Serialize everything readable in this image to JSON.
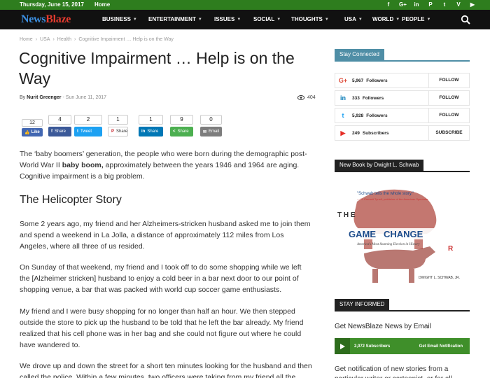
{
  "topbar": {
    "date": "Thursday, June 15, 2017",
    "home": "Home",
    "social_icons": [
      "f",
      "G+",
      "in",
      "P",
      "t",
      "V",
      "▶"
    ]
  },
  "nav": {
    "logo_a": "News",
    "logo_b": "Blaze",
    "items": [
      {
        "label": "BUSINESS",
        "caret": true
      },
      {
        "label": "ENTERTAINMENT",
        "caret": true
      },
      {
        "label": "ISSUES",
        "caret": true
      },
      {
        "label": "SOCIAL",
        "caret": true
      },
      {
        "label": "THOUGHTS",
        "caret": true
      },
      {
        "label": "USA",
        "caret": true
      },
      {
        "label": "WORLD",
        "caret": true
      },
      {
        "label": "PEOPLE",
        "caret": true
      }
    ]
  },
  "breadcrumb": [
    "Home",
    "›",
    "USA",
    "›",
    "Health",
    "›",
    "Cognitive Impairment … Help is on the Way"
  ],
  "article": {
    "title": "Cognitive Impairment … Help is on the Way",
    "by": "By",
    "author": "Nurit Greenger",
    "dash": "-",
    "date": "Sun June 11, 2017",
    "views": "404",
    "like_count": "12",
    "like_label": "Like",
    "shares": [
      {
        "count": "4",
        "label": "Share",
        "icon": "f",
        "color": "#3b5998"
      },
      {
        "count": "2",
        "label": "Tweet",
        "icon": "t",
        "color": "#1da1f2"
      },
      {
        "count": "1",
        "label": "Share",
        "icon": "P",
        "color": "#ffffff"
      },
      {
        "count": "1",
        "label": "Share",
        "icon": "in",
        "color": "#0077b5"
      },
      {
        "count": "9",
        "label": "Share",
        "icon": "<",
        "color": "#4caf50"
      },
      {
        "count": "0",
        "label": "Email",
        "icon": "✉",
        "color": "#7d7d7d"
      }
    ],
    "p1_a": "The ‘baby boomers’ generation, the people who were born during the demographic post-World War II ",
    "p1_b": "baby boom,",
    "p1_c": " approximately between the years 1946 and 1964 are aging. Cognitive impairment is a big problem.",
    "subhead": "The Helicopter Story",
    "p2": "Some 2 years ago, my friend and her Alzheimers-stricken husband asked me to join them and spend a weekend in La Jolla, a distance of approximately 112 miles from Los Angeles, where all three of us resided.",
    "p3": "On Sunday of that weekend, my friend and I took off to do some shopping while we left the [Alzheimer stricken] husband to enjoy a cold beer in a bar next door to our point of shopping venue, a bar that was packed with world cup soccer game enthusiasts.",
    "p4": "My friend and I were busy shopping for no longer than half an hour. We then stepped outside the store to pick up the husband to be told that he left the bar already. My friend realized that his cell phone was in her bag and she could not figure out where he could have wandered to.",
    "p5": "We drove up and down the street for a short ten minutes looking for the husband and then called the police. Within a few minutes, two officers were taking from my friend all the"
  },
  "sidebar": {
    "stay_connected": "Stay Connected",
    "rows": [
      {
        "icon": "G+",
        "color": "#dd4b39",
        "count": "5,967",
        "label": "Followers",
        "action": "FOLLOW"
      },
      {
        "icon": "in",
        "color": "#0077b5",
        "count": "333",
        "label": "Followers",
        "action": "FOLLOW"
      },
      {
        "icon": "t",
        "color": "#1da1f2",
        "count": "5,928",
        "label": "Followers",
        "action": "FOLLOW"
      },
      {
        "icon": "▶",
        "color": "#e52d27",
        "count": "249",
        "label": "Subscribers",
        "action": "SUBSCRIBE"
      }
    ],
    "new_book": "New Book by Dwight L. Schwab",
    "book": {
      "quote": "\"Schwab tells the whole story.\"",
      "attribution": "— R. Emmett Tyrrell, publisher of the American Spectator",
      "letters_a": "T H E",
      "game": "GAME",
      "changer": "CHANGE",
      "letters_b": "R",
      "subtitle": "America's Most Stunning Election in History",
      "author": "DWIGHT L. SCHWAB, JR."
    },
    "stay_informed": "STAY INFORMED",
    "get_news": "Get NewsBlaze News by Email",
    "subscribers": "2,072 Subscribers",
    "get_email": "Get Email Notification",
    "notif_text": "Get notification of new stories from a particular writer or cartoonist, or for all writers"
  },
  "colors": {
    "topbar": "#2e7d1e",
    "nav": "#111111",
    "stay_connected": "#4f8ea6",
    "dark_tag": "#222222",
    "green": "#3f8f2a"
  }
}
